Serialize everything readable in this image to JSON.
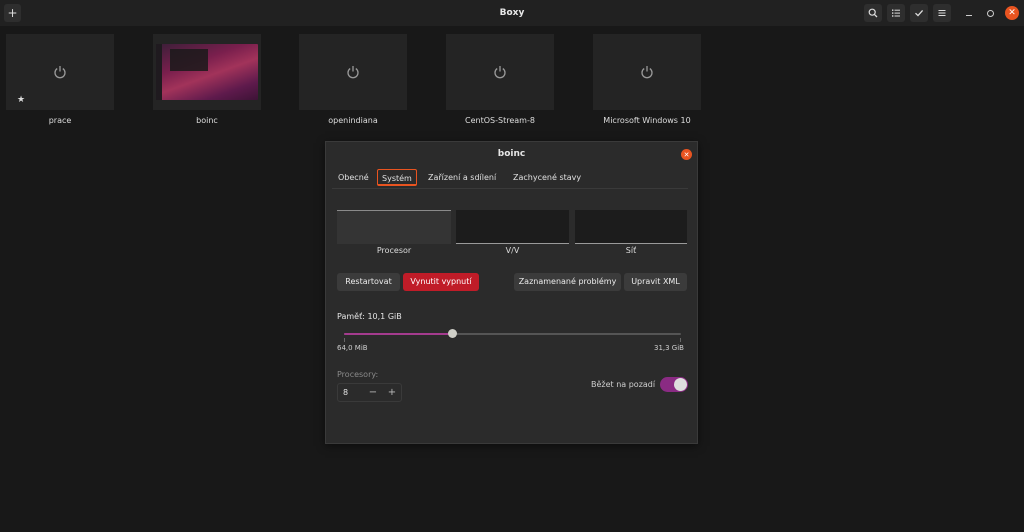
{
  "app": {
    "title": "Boxy"
  },
  "header": {
    "new_button_icon": "plus-icon",
    "tools": [
      "search-icon",
      "select-list-icon",
      "checkmark-icon",
      "menu-icon"
    ],
    "window_controls": [
      "minimize-icon",
      "maximize-icon",
      "close-icon"
    ]
  },
  "machines": [
    {
      "name": "prace",
      "state": "off",
      "favorite": true
    },
    {
      "name": "boinc",
      "state": "running",
      "favorite": false
    },
    {
      "name": "openindiana",
      "state": "off",
      "favorite": false
    },
    {
      "name": "CentOS-Stream-8",
      "state": "off",
      "favorite": false
    },
    {
      "name": "Microsoft Windows 10",
      "state": "off",
      "favorite": false
    }
  ],
  "dialog": {
    "title": "boinc",
    "tabs": [
      {
        "label": "Obecné",
        "active": false
      },
      {
        "label": "Systém",
        "active": true
      },
      {
        "label": "Zařízení a sdílení",
        "active": false
      },
      {
        "label": "Zachycené stavy",
        "active": false
      }
    ],
    "graphs": [
      "Procesor",
      "V/V",
      "Síť"
    ],
    "buttons": {
      "restart": "Restartovat",
      "force_off": "Vynutit vypnutí",
      "problems": "Zaznamenané problémy",
      "edit_xml": "Upravit XML"
    },
    "memory": {
      "label": "Paměť: 10,1 GiB",
      "min_label": "64,0 MiB",
      "max_label": "31,3 GiB",
      "fraction": 0.32
    },
    "cpus": {
      "label": "Procesory:",
      "value": "8",
      "decrement": "−",
      "increment": "+"
    },
    "background": {
      "label": "Běžet na pozadí",
      "enabled": true
    }
  },
  "colors": {
    "accent": "#e95420",
    "destructive": "#c01c28",
    "switch_on": "#8a2b83",
    "slider_fill": "#a43b8e"
  }
}
